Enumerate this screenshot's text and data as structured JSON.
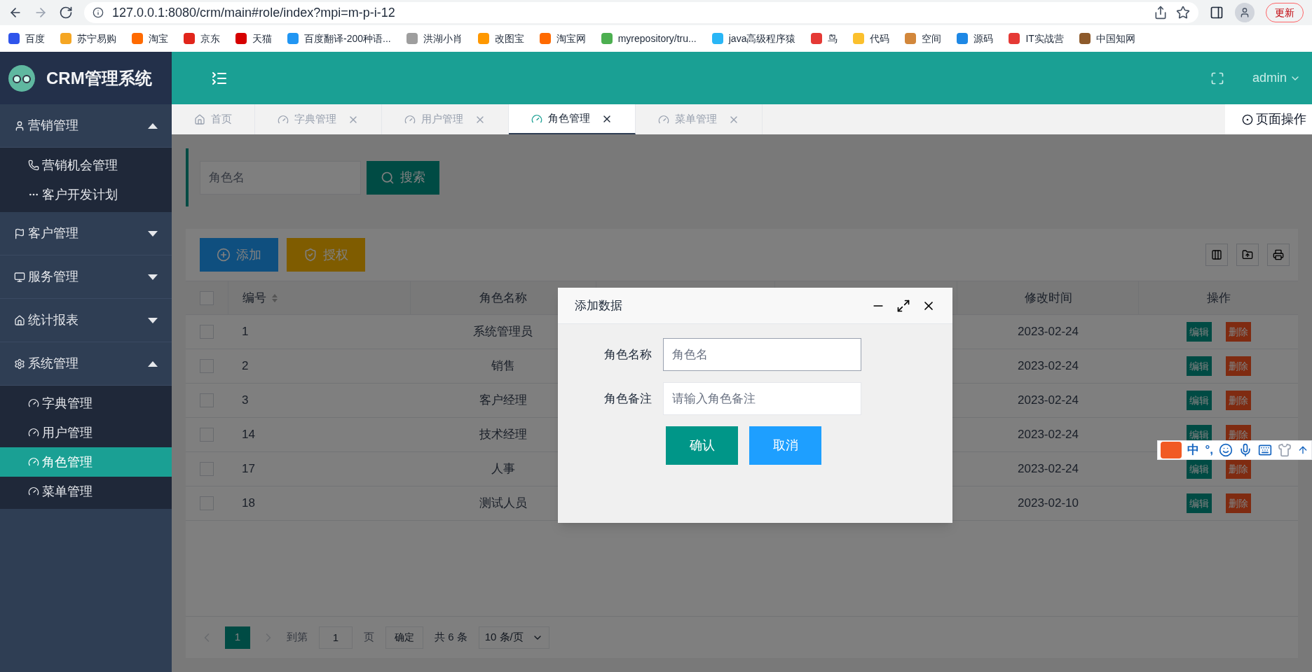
{
  "browser": {
    "url": "127.0.0.1:8080/crm/main#role/index?mpi=m-p-i-12",
    "update_button": "更新",
    "bookmarks": [
      "百度",
      "苏宁易购",
      "淘宝",
      "京东",
      "天猫",
      "百度翻译-200种语...",
      "洪湖小肖",
      "改图宝",
      "淘宝网",
      "myrepository/tru...",
      "java高级程序猿",
      "鸟",
      "代码",
      "空间",
      "源码",
      "IT实战营",
      "中国知网"
    ]
  },
  "app": {
    "title": "CRM管理系统",
    "user": "admin"
  },
  "sidebar": [
    {
      "label": "营销管理",
      "expanded": true,
      "children": [
        {
          "label": "营销机会管理",
          "selected": false
        },
        {
          "label": "客户开发计划",
          "selected": false
        }
      ]
    },
    {
      "label": "客户管理",
      "expanded": false
    },
    {
      "label": "服务管理",
      "expanded": false
    },
    {
      "label": "统计报表",
      "expanded": false
    },
    {
      "label": "系统管理",
      "expanded": true,
      "children": [
        {
          "label": "字典管理",
          "selected": false
        },
        {
          "label": "用户管理",
          "selected": false
        },
        {
          "label": "角色管理",
          "selected": true
        },
        {
          "label": "菜单管理",
          "selected": false
        }
      ]
    }
  ],
  "tabs": [
    {
      "label": "首页",
      "closable": false,
      "selected": false
    },
    {
      "label": "字典管理",
      "closable": true,
      "selected": false
    },
    {
      "label": "用户管理",
      "closable": true,
      "selected": false
    },
    {
      "label": "角色管理",
      "closable": true,
      "selected": true
    },
    {
      "label": "菜单管理",
      "closable": true,
      "selected": false
    }
  ],
  "page_actions": "页面操作",
  "search": {
    "placeholder": "角色名",
    "button": "搜索"
  },
  "toolbar": {
    "add": "添加",
    "grant": "授权"
  },
  "table": {
    "select_all_checked": false,
    "columns": [
      "编号",
      "角色名称",
      "修改时间",
      "操作"
    ],
    "rows": [
      {
        "checked": false,
        "id": "1",
        "name": "系统管理员",
        "modified": "2023-02-24",
        "actions": [
          "编辑",
          "删除"
        ]
      },
      {
        "checked": false,
        "id": "2",
        "name": "销售",
        "modified": "2023-02-24",
        "actions": [
          "编辑",
          "删除"
        ]
      },
      {
        "checked": false,
        "id": "3",
        "name": "客户经理",
        "modified": "2023-02-24",
        "actions": [
          "编辑",
          "删除"
        ]
      },
      {
        "checked": false,
        "id": "14",
        "name": "技术经理",
        "modified": "2023-02-24",
        "actions": [
          "编辑",
          "删除"
        ]
      },
      {
        "checked": false,
        "id": "17",
        "name": "人事",
        "modified": "2023-02-24",
        "actions": [
          "编辑",
          "删除"
        ]
      },
      {
        "checked": false,
        "id": "18",
        "name": "测试人员",
        "modified": "2023-02-10",
        "actions": [
          "编辑",
          "删除"
        ]
      }
    ]
  },
  "pagination": {
    "current": "1",
    "goto_label": "到第",
    "goto_value": "1",
    "page_unit": "页",
    "confirm": "确定",
    "total": "共 6 条",
    "page_size": "10 条/页"
  },
  "dialog": {
    "title": "添加数据",
    "fields": [
      {
        "label": "角色名称",
        "placeholder": "角色名"
      },
      {
        "label": "角色备注",
        "placeholder": "请输入角色备注"
      }
    ],
    "confirm": "确认",
    "cancel": "取消"
  },
  "ime_bar": {
    "mode": "中",
    "punct": "°,"
  }
}
